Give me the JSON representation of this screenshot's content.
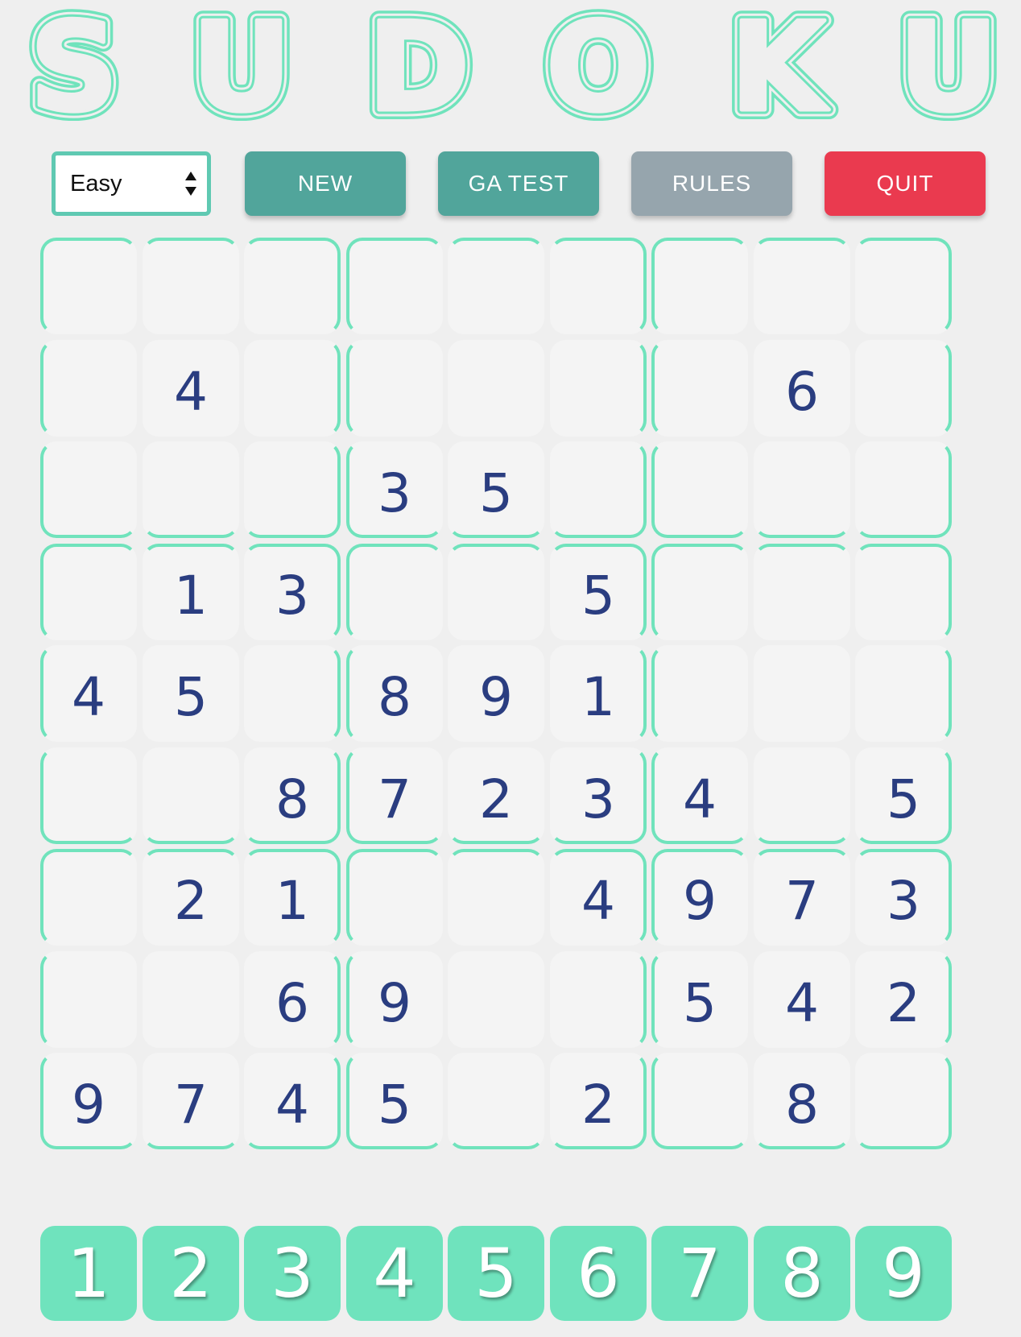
{
  "title": {
    "letters": [
      "S",
      "U",
      "D",
      "O",
      "K",
      "U"
    ],
    "color": "#70e3bc"
  },
  "controls": {
    "difficulty": {
      "selected": "Easy"
    },
    "new_label": "NEW",
    "ga_test_label": "GA TEST",
    "rules_label": "RULES",
    "quit_label": "QUIT"
  },
  "board": [
    [
      "",
      "",
      "",
      "",
      "",
      "",
      "",
      "",
      ""
    ],
    [
      "",
      "4",
      "",
      "",
      "",
      "",
      "",
      "6",
      ""
    ],
    [
      "",
      "",
      "",
      "3",
      "5",
      "",
      "",
      "",
      ""
    ],
    [
      "",
      "1",
      "3",
      "",
      "",
      "5",
      "",
      "",
      ""
    ],
    [
      "4",
      "5",
      "",
      "8",
      "9",
      "1",
      "",
      "",
      ""
    ],
    [
      "",
      "",
      "8",
      "7",
      "2",
      "3",
      "4",
      "",
      "5"
    ],
    [
      "",
      "2",
      "1",
      "",
      "",
      "4",
      "9",
      "7",
      "3"
    ],
    [
      "",
      "",
      "6",
      "9",
      "",
      "",
      "5",
      "4",
      "2"
    ],
    [
      "9",
      "7",
      "4",
      "5",
      "",
      "2",
      "",
      "8",
      ""
    ]
  ],
  "numpad": [
    "1",
    "2",
    "3",
    "4",
    "5",
    "6",
    "7",
    "8",
    "9"
  ],
  "colors": {
    "accent": "#70e3bc",
    "digit": "#2a3d80",
    "button_teal": "#51a59b",
    "button_gray": "#96a5ad",
    "button_red": "#ea3a4f"
  }
}
